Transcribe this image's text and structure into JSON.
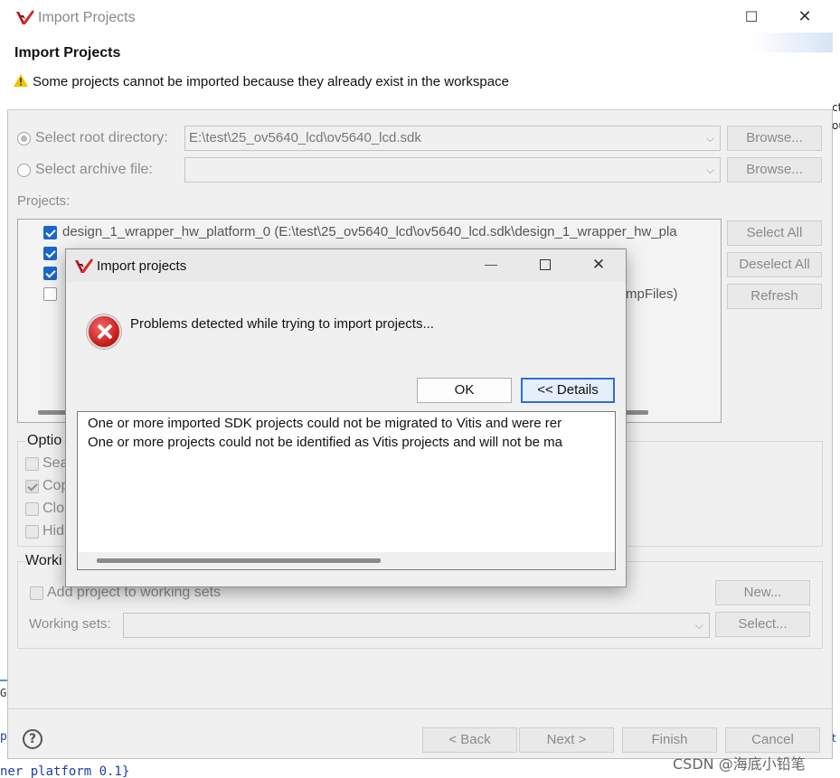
{
  "window": {
    "title": "Import Projects",
    "header_title": "Import Projects",
    "header_message": "Some projects cannot be imported because they already exist in the workspace"
  },
  "source": {
    "root_label": "Select root directory:",
    "root_value": "E:\\test\\25_ov5640_lcd\\ov5640_lcd.sdk",
    "archive_label": "Select archive file:",
    "archive_value": "",
    "browse_label": "Browse..."
  },
  "projects": {
    "label": "Projects:",
    "items": [
      {
        "text": "design_1_wrapper_hw_platform_0 (E:\\test\\25_ov5640_lcd\\ov5640_lcd.sdk\\design_1_wrapper_hw_pla"
      },
      {
        "text": "mpFiles)"
      }
    ],
    "select_all": "Select All",
    "deselect_all": "Deselect All",
    "refresh": "Refresh"
  },
  "options": {
    "label": "Optio",
    "items": [
      "Sea",
      "Cop",
      "Clo",
      "Hid"
    ]
  },
  "working_sets": {
    "label": "Worki",
    "add_label": "Add project to working sets",
    "sets_label": "Working sets:",
    "new_label": "New...",
    "select_label": "Select..."
  },
  "footer": {
    "back": "< Back",
    "next": "Next >",
    "finish": "Finish",
    "cancel": "Cancel",
    "help": "?"
  },
  "dialog": {
    "title": "Import projects",
    "message": "Problems detected while trying to import projects...",
    "ok": "OK",
    "details": "<< Details",
    "detail_lines": [
      "One or more imported SDK projects could not be migrated to Vitis and were rer",
      "One or more projects could not be identified as Vitis projects and will not be ma"
    ]
  },
  "background": {
    "code_text": "ner platform 0.1}",
    "right_texts": [
      "ct",
      "ou",
      "t"
    ],
    "left_texts": [
      "p",
      "Gu"
    ]
  },
  "watermark": "CSDN @海底小铅笔"
}
